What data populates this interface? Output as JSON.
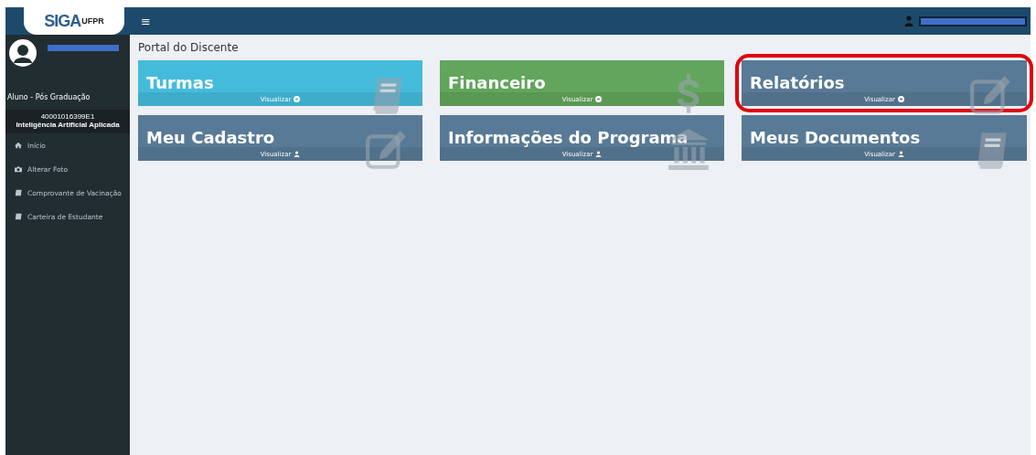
{
  "header": {
    "logo": {
      "main": "SIGA",
      "sub": "UFPR"
    },
    "menu_glyph": "≡"
  },
  "sidebar": {
    "role": "Aluno - Pós Graduação",
    "registration": "40001016399E1",
    "program": "Inteligência Artificial Aplicada",
    "items": [
      {
        "label": "Início",
        "kind": "home"
      },
      {
        "label": "Alterar Foto",
        "kind": "camera"
      },
      {
        "label": "Comprovante de Vacinação",
        "kind": "book"
      },
      {
        "label": "Carteira de Estudante",
        "kind": "book"
      }
    ]
  },
  "page_title": "Portal do Discente",
  "tiles": [
    {
      "title": "Turmas",
      "link": {
        "text": "Visualizar",
        "kind": "arrow"
      },
      "kind": "book",
      "color": "#45bbdc",
      "highlighted": false
    },
    {
      "title": "Financeiro",
      "link": {
        "text": "Visualizar",
        "kind": "arrow"
      },
      "kind": "dollar",
      "color": "#62a55c",
      "highlighted": false
    },
    {
      "title": "Relatórios",
      "link": {
        "text": "Visualizar",
        "kind": "arrow"
      },
      "kind": "edit",
      "color": "#587a96",
      "highlighted": true
    },
    {
      "title": "Meu Cadastro",
      "link": {
        "text": "Visualizar",
        "kind": "user"
      },
      "kind": "edit",
      "color": "#587a96",
      "highlighted": false
    },
    {
      "title": "Informações do Programa",
      "link": {
        "text": "Visualizar",
        "kind": "user"
      },
      "kind": "bank",
      "color": "#587a96",
      "highlighted": false
    },
    {
      "title": "Meus Documentos",
      "link": {
        "text": "Visualizar",
        "kind": "user"
      },
      "kind": "book",
      "color": "#587a96",
      "highlighted": false
    }
  ]
}
